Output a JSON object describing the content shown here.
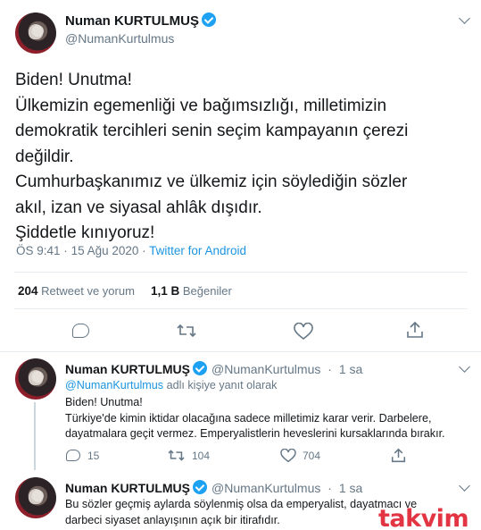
{
  "tweet": {
    "author": "Numan KURTULMUŞ",
    "handle": "@NumanKurtulmus",
    "lines": [
      "Biden! Unutma!",
      "Ülkemizin egemenliği ve bağımsızlığı, milletimizin",
      "demokratik tercihleri senin seçim kampayanın çerezi",
      "değildir.",
      "Cumhurbaşkanımız ve ülkemiz için söylediğin sözler",
      "akıl, izan ve siyasal ahlâk dışıdır.",
      "Şiddetle kınıyoruz!"
    ],
    "time": "ÖS 9:41",
    "date": "15 Ağu 2020",
    "separator": "·",
    "source": "Twitter for Android",
    "retweet_count": "204",
    "retweet_label": "Retweet ve yorum",
    "like_count": "1,1 B",
    "like_label": "Beğeniler"
  },
  "replies": [
    {
      "author": "Numan KURTULMUŞ",
      "handle": "@NumanKurtulmus",
      "dot": "·",
      "time": "1 sa",
      "reply_to_mention": "@NumanKurtulmus",
      "reply_to_suffix": "adlı kişiye yanıt olarak",
      "lines": [
        "Biden! Unutma!",
        "Türkiye'de kimin iktidar olacağına sadece milletimiz karar verir. Darbelere,",
        "dayatmalara geçit vermez. Emperyalistlerin heveslerini kursaklarında bırakır."
      ],
      "replies": "15",
      "retweets": "104",
      "likes": "704"
    },
    {
      "author": "Numan KURTULMUŞ",
      "handle": "@NumanKurtulmus",
      "dot": "·",
      "time": "1 sa",
      "lines": [
        "Bu sözler geçmiş aylarda söylenmiş olsa da emperyalist, dayatmacı ve",
        "darbeci siyaset anlayışının açık bir itirafıdır."
      ]
    }
  ],
  "watermark": "takvim",
  "colors": {
    "link": "#1b95e0",
    "verified": "#1da1f2",
    "muted": "#657786",
    "divider": "#e6ecf0"
  },
  "icons": [
    "verified-badge-icon",
    "chevron-down-icon",
    "reply-icon",
    "retweet-icon",
    "like-icon",
    "share-icon"
  ]
}
